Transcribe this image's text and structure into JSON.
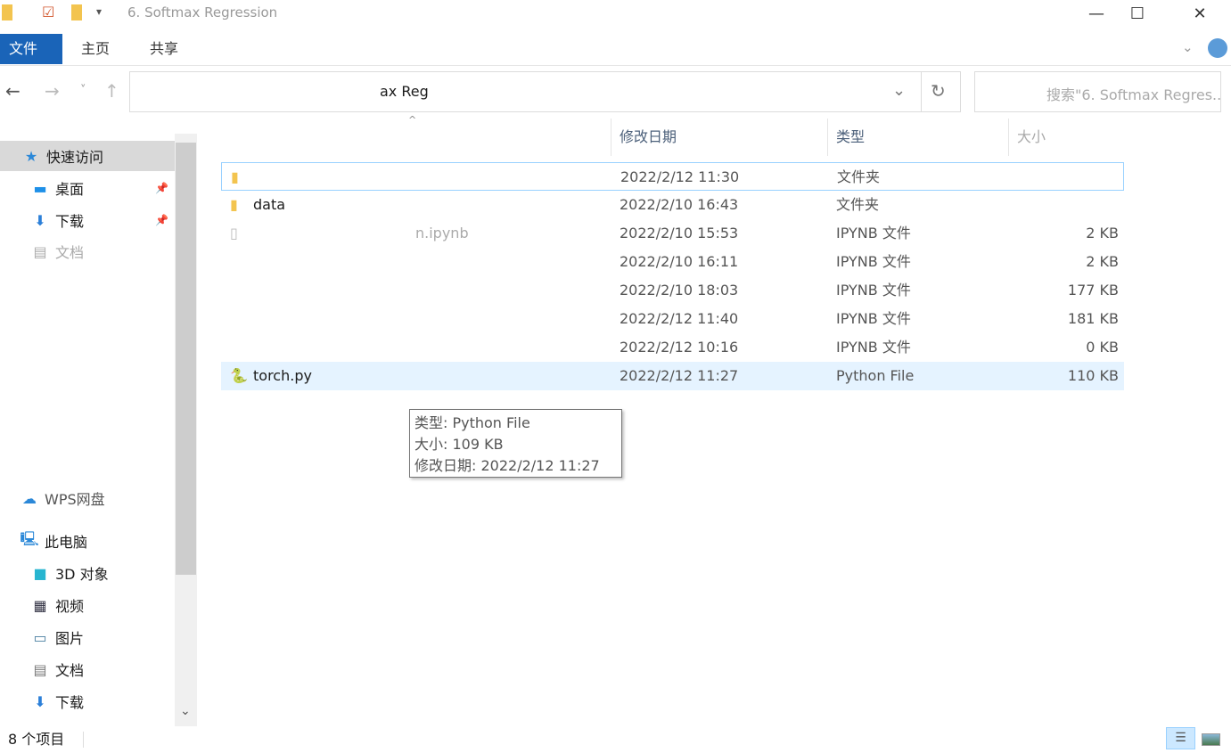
{
  "window": {
    "title": "6. Softmax Regression",
    "minimize": "—",
    "maximize": "☐",
    "close": "✕"
  },
  "ribbon": {
    "tabs": [
      "文件",
      "主页",
      "共享"
    ]
  },
  "nav": {
    "back": "←",
    "forward": "→",
    "recent": "˅",
    "up": "↑",
    "address": "ax Reg",
    "address_dropdown": "⌄",
    "refresh": "↻",
    "search_placeholder": "搜索\"6. Softmax Regres..."
  },
  "sidebar": {
    "items": [
      {
        "label": "快速访问",
        "icon": "star-icon"
      },
      {
        "label": "桌面",
        "icon": "desktop-icon"
      },
      {
        "label": "下载",
        "icon": "download-icon"
      },
      {
        "label": "文档",
        "icon": "document-icon"
      },
      {
        "label": "WPS网盘",
        "icon": "cloud-icon"
      },
      {
        "label": "此电脑",
        "icon": "computer-icon"
      },
      {
        "label": "3D 对象",
        "icon": "cube-icon"
      },
      {
        "label": "视频",
        "icon": "video-icon"
      },
      {
        "label": "图片",
        "icon": "picture-icon"
      },
      {
        "label": "文档",
        "icon": "document-icon"
      },
      {
        "label": "下载",
        "icon": "download-icon"
      }
    ]
  },
  "columns": {
    "date": "修改日期",
    "type": "类型",
    "size": "大小"
  },
  "files": [
    {
      "name": "",
      "date": "2022/2/12 11:30",
      "type": "文件夹",
      "size": ""
    },
    {
      "name": "data",
      "date": "2022/2/10 16:43",
      "type": "文件夹",
      "size": ""
    },
    {
      "name": "n.ipynb",
      "date": "2022/2/10 15:53",
      "type": "IPYNB 文件",
      "size": "2 KB"
    },
    {
      "name": "",
      "date": "2022/2/10 16:11",
      "type": "IPYNB 文件",
      "size": "2 KB"
    },
    {
      "name": "",
      "date": "2022/2/10 18:03",
      "type": "IPYNB 文件",
      "size": "177 KB"
    },
    {
      "name": "",
      "date": "2022/2/12 11:40",
      "type": "IPYNB 文件",
      "size": "181 KB"
    },
    {
      "name": "",
      "date": "2022/2/12 10:16",
      "type": "IPYNB 文件",
      "size": "0 KB"
    },
    {
      "name": "torch.py",
      "date": "2022/2/12 11:27",
      "type": "Python File",
      "size": "110 KB"
    }
  ],
  "tooltip": {
    "type": "类型: Python File",
    "size": "大小: 109 KB",
    "date": "修改日期: 2022/2/12 11:27"
  },
  "status": {
    "count": "8 个项目"
  },
  "colors": {
    "file_tab": "#1a64b8",
    "selection": "#e5f3ff"
  }
}
